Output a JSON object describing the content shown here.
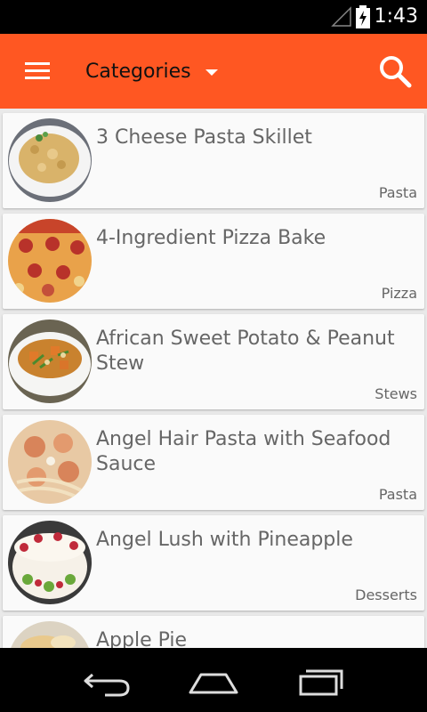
{
  "status_bar": {
    "time": "1:43"
  },
  "app_bar": {
    "title": "Categories"
  },
  "recipes": [
    {
      "title": "3 Cheese Pasta Skillet",
      "category": "Pasta"
    },
    {
      "title": "4-Ingredient Pizza Bake",
      "category": "Pizza"
    },
    {
      "title": "African Sweet Potato & Peanut Stew",
      "category": "Stews"
    },
    {
      "title": "Angel Hair Pasta with Seafood Sauce",
      "category": "Pasta"
    },
    {
      "title": "Angel Lush with Pineapple",
      "category": "Desserts"
    },
    {
      "title": "Apple Pie",
      "category": ""
    }
  ],
  "colors": {
    "accent": "#ff5722",
    "card_bg": "#fafafa",
    "list_bg": "#e9e9e9"
  }
}
